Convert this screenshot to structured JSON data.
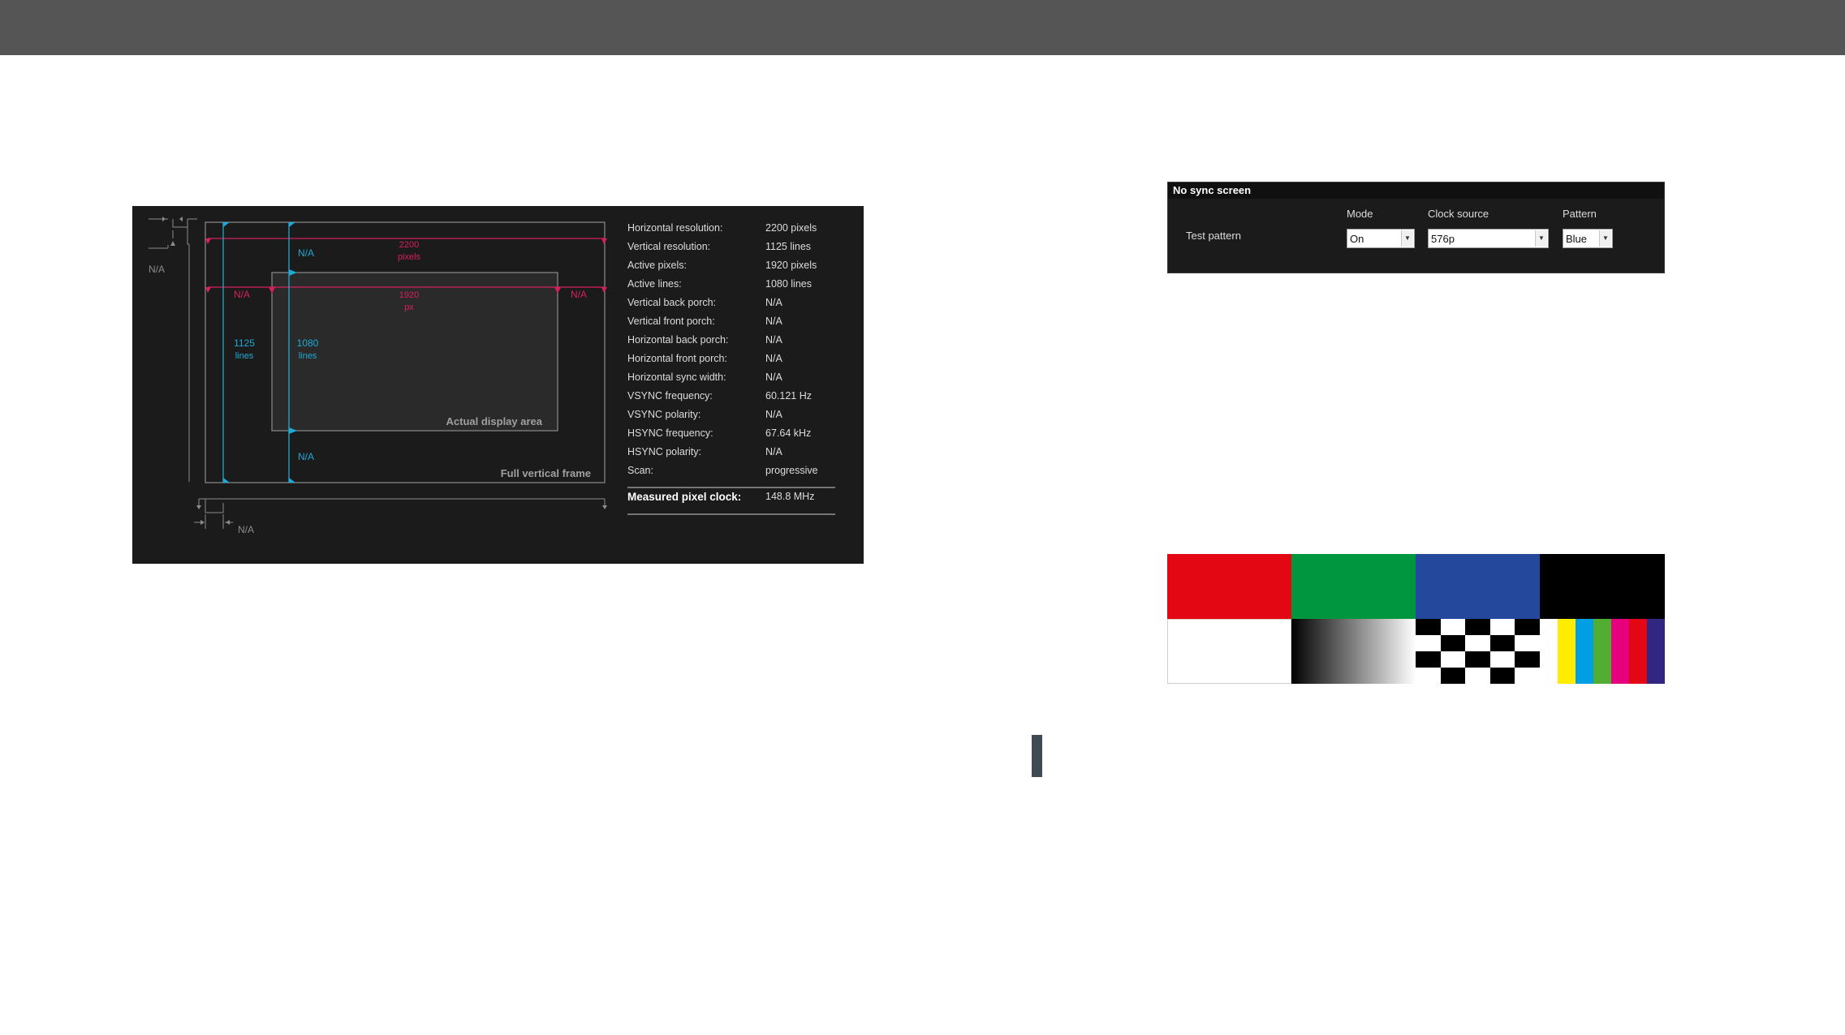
{
  "timing_diagram": {
    "labels": {
      "na_left": "N/A",
      "na_top": "N/A",
      "total_pixels_value": "2200",
      "total_pixels_unit": "pixels",
      "na_hfp": "N/A",
      "active_pixels_value": "1920",
      "active_pixels_unit": "px",
      "na_hbp": "N/A",
      "total_lines_value": "1125",
      "total_lines_unit": "lines",
      "active_lines_value": "1080",
      "active_lines_unit": "lines",
      "actual_display_area": "Actual display area",
      "na_bottom": "N/A",
      "full_vertical_frame": "Full vertical frame",
      "na_hsync": "N/A"
    },
    "info": [
      {
        "key": "Horizontal resolution:",
        "value": "2200 pixels"
      },
      {
        "key": "Vertical resolution:",
        "value": "1125 lines"
      },
      {
        "key": "Active pixels:",
        "value": "1920 pixels"
      },
      {
        "key": "Active lines:",
        "value": "1080 lines"
      },
      {
        "key": "Vertical back porch:",
        "value": "N/A"
      },
      {
        "key": "Vertical front porch:",
        "value": "N/A"
      },
      {
        "key": "Horizontal back porch:",
        "value": "N/A"
      },
      {
        "key": "Horizontal front porch:",
        "value": "N/A"
      },
      {
        "key": "Horizontal sync width:",
        "value": "N/A"
      },
      {
        "key": "VSYNC frequency:",
        "value": "60.121 Hz"
      },
      {
        "key": "VSYNC polarity:",
        "value": "N/A"
      },
      {
        "key": "HSYNC frequency:",
        "value": "67.64 kHz"
      },
      {
        "key": "HSYNC polarity:",
        "value": "N/A"
      },
      {
        "key": "Scan:",
        "value": "progressive"
      }
    ],
    "pixel_clock": {
      "key": "Measured pixel clock:",
      "value": "148.8 MHz"
    },
    "colors": {
      "cyan": "#1fa9d6",
      "magenta": "#d6205a",
      "frame": "#8c8c8c"
    }
  },
  "no_sync_screen": {
    "title": "No sync screen",
    "row_label": "Test pattern",
    "mode": {
      "label": "Mode",
      "value": "On"
    },
    "clock_source": {
      "label": "Clock source",
      "value": "576p"
    },
    "pattern": {
      "label": "Pattern",
      "value": "Blue"
    }
  },
  "test_patterns": {
    "colors": {
      "red": "#e30613",
      "green": "#009640",
      "blue": "#24489b",
      "black": "#000000",
      "white": "#ffffff"
    },
    "color_bars": [
      "#ffffff",
      "#ffed00",
      "#009fe3",
      "#52ae32",
      "#e6007e",
      "#e30613",
      "#312783"
    ]
  }
}
